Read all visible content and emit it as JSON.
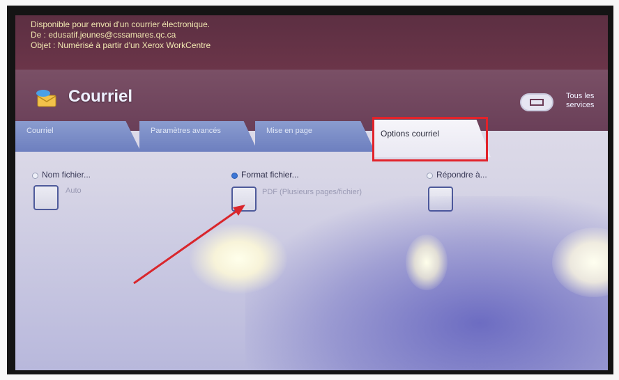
{
  "banner": {
    "line1": "Disponible pour envoi d'un courrier électronique.",
    "line2": "De : edusatif.jeunes@cssamares.qc.ca",
    "line3": "Objet : Numérisé à partir d'un Xerox WorkCentre"
  },
  "header": {
    "title": "Courriel",
    "all_services": "Tous les services"
  },
  "tabs": [
    {
      "label": "Courriel"
    },
    {
      "label": "Paramètres avancés"
    },
    {
      "label": "Mise en page"
    },
    {
      "label": "Options courriel"
    }
  ],
  "options": [
    {
      "label": "Nom fichier...",
      "value": "Auto",
      "selected": false
    },
    {
      "label": "Format fichier...",
      "value": "PDF (Plusieurs pages/fichier)",
      "selected": true
    },
    {
      "label": "Répondre à...",
      "value": "",
      "selected": false
    }
  ],
  "colors": {
    "highlight": "#e2222a",
    "radio_selected": "#3c76d6"
  }
}
